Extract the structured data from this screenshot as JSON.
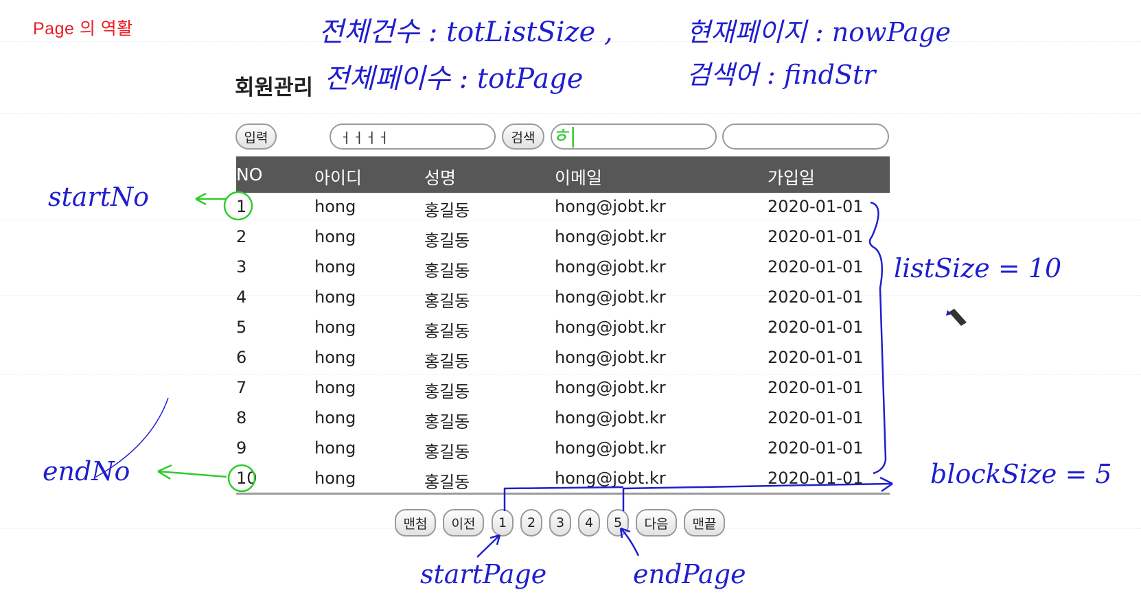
{
  "slide_title": "Page 의 역활",
  "page_heading": "회원관리",
  "toolbar": {
    "input_button": "입력",
    "search_button": "검색",
    "field1_value": "ㅓㅓㅓㅓ",
    "field2_value": "",
    "field3_value": ""
  },
  "table": {
    "headers": [
      "NO",
      "아이디",
      "성명",
      "이메일",
      "가입일"
    ],
    "rows": [
      [
        "1",
        "hong",
        "홍길동",
        "hong@jobt.kr",
        "2020-01-01"
      ],
      [
        "2",
        "hong",
        "홍길동",
        "hong@jobt.kr",
        "2020-01-01"
      ],
      [
        "3",
        "hong",
        "홍길동",
        "hong@jobt.kr",
        "2020-01-01"
      ],
      [
        "4",
        "hong",
        "홍길동",
        "hong@jobt.kr",
        "2020-01-01"
      ],
      [
        "5",
        "hong",
        "홍길동",
        "hong@jobt.kr",
        "2020-01-01"
      ],
      [
        "6",
        "hong",
        "홍길동",
        "hong@jobt.kr",
        "2020-01-01"
      ],
      [
        "7",
        "hong",
        "홍길동",
        "hong@jobt.kr",
        "2020-01-01"
      ],
      [
        "8",
        "hong",
        "홍길동",
        "hong@jobt.kr",
        "2020-01-01"
      ],
      [
        "9",
        "hong",
        "홍길동",
        "hong@jobt.kr",
        "2020-01-01"
      ],
      [
        "10",
        "hong",
        "홍길동",
        "hong@jobt.kr",
        "2020-01-01"
      ]
    ]
  },
  "pager": {
    "first": "맨첨",
    "prev": "이전",
    "pages": [
      "1",
      "2",
      "3",
      "4",
      "5"
    ],
    "next": "다음",
    "last": "맨끝"
  },
  "annotations": {
    "tot_list_size": "전체건수 : totListSize ,",
    "now_page": "현재페이지 : nowPage",
    "tot_page": "전체페이수 : totPage",
    "find_str": "검색어 : findStr",
    "start_no": "startNo",
    "end_no": "endNo",
    "list_size": "listSize = 10",
    "block_size": "blockSize = 5",
    "start_page": "startPage",
    "end_page": "endPage"
  },
  "colors": {
    "title_red": "#ef1b24",
    "table_header": "#575757",
    "ink_blue": "#1f1fcf",
    "ink_green": "#2ecc2e"
  }
}
